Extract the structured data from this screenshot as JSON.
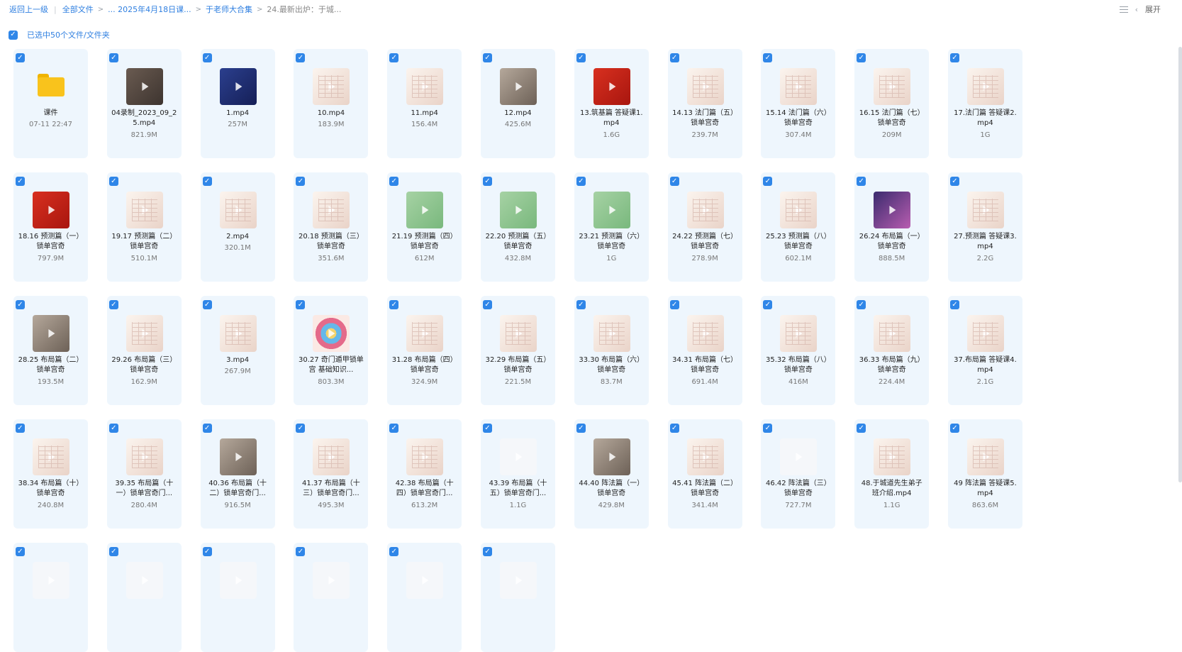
{
  "breadcrumb": {
    "back": "返回上一级",
    "all_files": "全部文件",
    "level2": "... 2025年4月18日课...",
    "level3": "于老师大合集",
    "current": "24.最新出炉：于城..."
  },
  "top_right": {
    "expand": "展开"
  },
  "selection": {
    "label": "已选中50个文件/文件夹"
  },
  "colors": {
    "accent": "#2f86e8",
    "card_bg": "#eef6fd",
    "folder": "#f9c31c"
  },
  "items": [
    {
      "name": "课件",
      "meta": "07-11 22:47",
      "kind": "folder"
    },
    {
      "name": "04录制_2023_09_25.mp4",
      "meta": "821.9M",
      "kind": "video",
      "thumb": "t-dark"
    },
    {
      "name": "1.mp4",
      "meta": "257M",
      "kind": "video",
      "thumb": "t-blue"
    },
    {
      "name": "10.mp4",
      "meta": "183.9M",
      "kind": "video",
      "thumb": "t-paper"
    },
    {
      "name": "11.mp4",
      "meta": "156.4M",
      "kind": "video",
      "thumb": "t-paper"
    },
    {
      "name": "12.mp4",
      "meta": "425.6M",
      "kind": "video",
      "thumb": "t-photo"
    },
    {
      "name": "13.筑基篇 答疑课1.mp4",
      "meta": "1.6G",
      "kind": "video",
      "thumb": "t-red"
    },
    {
      "name": "14.13 法门篇（五）锁单宫奇",
      "meta": "239.7M",
      "kind": "video",
      "thumb": "t-paper"
    },
    {
      "name": "15.14 法门篇（六）锁单宫奇",
      "meta": "307.4M",
      "kind": "video",
      "thumb": "t-paper"
    },
    {
      "name": "16.15 法门篇（七）锁单宫奇",
      "meta": "209M",
      "kind": "video",
      "thumb": "t-paper"
    },
    {
      "name": "17.法门篇 答疑课2.mp4",
      "meta": "1G",
      "kind": "video",
      "thumb": "t-paper"
    },
    {
      "name": "18.16 预测篇（一）锁单宫奇",
      "meta": "797.9M",
      "kind": "video",
      "thumb": "t-red"
    },
    {
      "name": "19.17 预测篇（二）锁单宫奇",
      "meta": "510.1M",
      "kind": "video",
      "thumb": "t-paper"
    },
    {
      "name": "2.mp4",
      "meta": "320.1M",
      "kind": "video",
      "thumb": "t-paper"
    },
    {
      "name": "20.18 预测篇（三）锁单宫奇",
      "meta": "351.6M",
      "kind": "video",
      "thumb": "t-paper"
    },
    {
      "name": "21.19 预测篇（四）锁单宫奇",
      "meta": "612M",
      "kind": "video",
      "thumb": "t-green"
    },
    {
      "name": "22.20 预测篇（五）锁单宫奇",
      "meta": "432.8M",
      "kind": "video",
      "thumb": "t-green"
    },
    {
      "name": "23.21 预测篇（六）锁单宫奇",
      "meta": "1G",
      "kind": "video",
      "thumb": "t-green"
    },
    {
      "name": "24.22 预测篇（七）锁单宫奇",
      "meta": "278.9M",
      "kind": "video",
      "thumb": "t-paper"
    },
    {
      "name": "25.23 预测篇（八）锁单宫奇",
      "meta": "602.1M",
      "kind": "video",
      "thumb": "t-paper"
    },
    {
      "name": "26.24 布局篇（一）锁单宫奇",
      "meta": "888.5M",
      "kind": "video",
      "thumb": "t-purple"
    },
    {
      "name": "27.预测篇 答疑课3.mp4",
      "meta": "2.2G",
      "kind": "video",
      "thumb": "t-paper"
    },
    {
      "name": "28.25 布局篇（二）锁单宫奇",
      "meta": "193.5M",
      "kind": "video",
      "thumb": "t-photo"
    },
    {
      "name": "29.26 布局篇（三）锁单宫奇",
      "meta": "162.9M",
      "kind": "video",
      "thumb": "t-paper"
    },
    {
      "name": "3.mp4",
      "meta": "267.9M",
      "kind": "video",
      "thumb": "t-paper"
    },
    {
      "name": "30.27 奇门遁甲锁单宫 基础知识...",
      "meta": "803.3M",
      "kind": "video",
      "thumb": "t-wheel"
    },
    {
      "name": "31.28 布局篇（四）锁单宫奇",
      "meta": "324.9M",
      "kind": "video",
      "thumb": "t-paper"
    },
    {
      "name": "32.29 布局篇（五）锁单宫奇",
      "meta": "221.5M",
      "kind": "video",
      "thumb": "t-paper"
    },
    {
      "name": "33.30 布局篇（六）锁单宫奇",
      "meta": "83.7M",
      "kind": "video",
      "thumb": "t-paper"
    },
    {
      "name": "34.31 布局篇（七）锁单宫奇",
      "meta": "691.4M",
      "kind": "video",
      "thumb": "t-paper"
    },
    {
      "name": "35.32 布局篇（八）锁单宫奇",
      "meta": "416M",
      "kind": "video",
      "thumb": "t-paper"
    },
    {
      "name": "36.33 布局篇（九）锁单宫奇",
      "meta": "224.4M",
      "kind": "video",
      "thumb": "t-paper"
    },
    {
      "name": "37.布局篇 答疑课4.mp4",
      "meta": "2.1G",
      "kind": "video",
      "thumb": "t-paper"
    },
    {
      "name": "38.34 布局篇（十）锁单宫奇",
      "meta": "240.8M",
      "kind": "video",
      "thumb": "t-paper"
    },
    {
      "name": "39.35 布局篇（十一）锁单宫奇门...",
      "meta": "280.4M",
      "kind": "video",
      "thumb": "t-paper"
    },
    {
      "name": "40.36 布局篇（十二）锁单宫奇门...",
      "meta": "916.5M",
      "kind": "video",
      "thumb": "t-photo"
    },
    {
      "name": "41.37 布局篇（十三）锁单宫奇门...",
      "meta": "495.3M",
      "kind": "video",
      "thumb": "t-paper"
    },
    {
      "name": "42.38 布局篇（十四）锁单宫奇门...",
      "meta": "613.2M",
      "kind": "video",
      "thumb": "t-paper"
    },
    {
      "name": "43.39 布局篇（十五）锁单宫奇门...",
      "meta": "1.1G",
      "kind": "video",
      "thumb": "t-white"
    },
    {
      "name": "44.40 阵法篇（一）锁单宫奇",
      "meta": "429.8M",
      "kind": "video",
      "thumb": "t-photo"
    },
    {
      "name": "45.41 阵法篇（二）锁单宫奇",
      "meta": "341.4M",
      "kind": "video",
      "thumb": "t-paper"
    },
    {
      "name": "46.42 阵法篇（三）锁单宫奇",
      "meta": "727.7M",
      "kind": "video",
      "thumb": "t-white"
    },
    {
      "name": "48.于城道先生弟子班介绍.mp4",
      "meta": "1.1G",
      "kind": "video",
      "thumb": "t-paper"
    },
    {
      "name": "49 阵法篇 答疑课5.mp4",
      "meta": "863.6M",
      "kind": "video",
      "thumb": "t-paper"
    },
    {
      "name": "",
      "meta": "",
      "kind": "video",
      "thumb": "t-white"
    },
    {
      "name": "",
      "meta": "",
      "kind": "video",
      "thumb": "t-white"
    },
    {
      "name": "",
      "meta": "",
      "kind": "video",
      "thumb": "t-white"
    },
    {
      "name": "",
      "meta": "",
      "kind": "video",
      "thumb": "t-white"
    },
    {
      "name": "",
      "meta": "",
      "kind": "video",
      "thumb": "t-white"
    },
    {
      "name": "",
      "meta": "",
      "kind": "video",
      "thumb": "t-white"
    }
  ]
}
